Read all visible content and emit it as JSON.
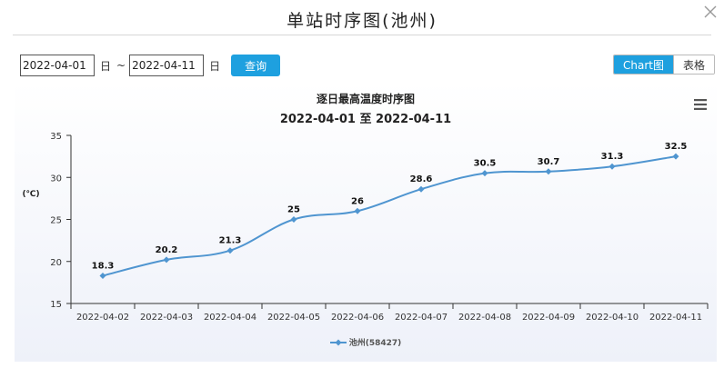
{
  "dialog": {
    "title": "单站时序图(池州)"
  },
  "toolbar": {
    "start_date": "2022-04-01",
    "day_label_1": "日",
    "range_sep": "~",
    "end_date": "2022-04-11",
    "day_label_2": "日",
    "query_label": "查询"
  },
  "view_toggle": {
    "chart_label": "Chart图",
    "table_label": "表格",
    "active": "chart"
  },
  "colors": {
    "accent": "#1ea0df",
    "series": "#4f95d0"
  },
  "chart_data": {
    "type": "line",
    "title": "逐日最高温度时序图",
    "subtitle": "2022-04-01 至 2022-04-11",
    "ylabel": "(℃)",
    "xlabel": "",
    "ylim": [
      15,
      35
    ],
    "yticks": [
      15,
      20,
      25,
      30,
      35
    ],
    "grid": false,
    "legend": "bottom",
    "categories": [
      "2022-04-02",
      "2022-04-03",
      "2022-04-04",
      "2022-04-05",
      "2022-04-06",
      "2022-04-07",
      "2022-04-08",
      "2022-04-09",
      "2022-04-10",
      "2022-04-11"
    ],
    "series": [
      {
        "name": "池州(58427)",
        "values": [
          18.3,
          20.2,
          21.3,
          25,
          26,
          28.6,
          30.5,
          30.7,
          31.3,
          32.5
        ]
      }
    ]
  }
}
